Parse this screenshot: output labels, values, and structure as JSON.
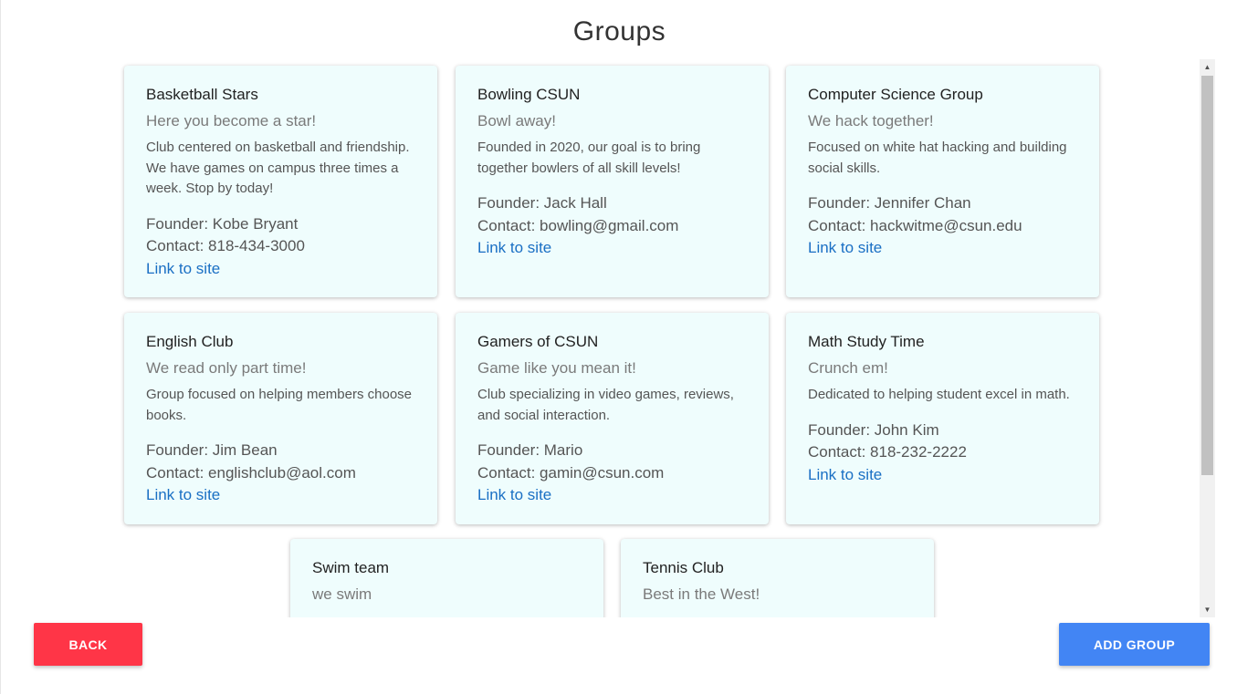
{
  "page": {
    "title": "Groups"
  },
  "groups": [
    {
      "name": "Basketball Stars",
      "tagline": "Here you become a star!",
      "description": "Club centered on basketball and friendship. We have games on campus three times a week. Stop by today!",
      "founder": "Founder: Kobe Bryant",
      "contact": "Contact: 818-434-3000",
      "link": "Link to site"
    },
    {
      "name": "Bowling CSUN",
      "tagline": "Bowl away!",
      "description": "Founded in 2020, our goal is to bring together bowlers of all skill levels!",
      "founder": "Founder: Jack Hall",
      "contact": "Contact: bowling@gmail.com",
      "link": "Link to site"
    },
    {
      "name": "Computer Science Group",
      "tagline": "We hack together!",
      "description": "Focused on white hat hacking and building social skills.",
      "founder": "Founder: Jennifer Chan",
      "contact": "Contact: hackwitme@csun.edu",
      "link": "Link to site"
    },
    {
      "name": "English Club",
      "tagline": "We read only part time!",
      "description": "Group focused on helping members choose books.",
      "founder": "Founder: Jim Bean",
      "contact": "Contact: englishclub@aol.com",
      "link": "Link to site"
    },
    {
      "name": "Gamers of CSUN",
      "tagline": "Game like you mean it!",
      "description": "Club specializing in video games, reviews, and social interaction.",
      "founder": "Founder: Mario",
      "contact": "Contact: gamin@csun.com",
      "link": "Link to site"
    },
    {
      "name": "Math Study Time",
      "tagline": "Crunch em!",
      "description": "Dedicated to helping student excel in math.",
      "founder": "Founder: John Kim",
      "contact": "Contact: 818-232-2222",
      "link": "Link to site"
    },
    {
      "name": "Swim team",
      "tagline": "we swim"
    },
    {
      "name": "Tennis Club",
      "tagline": "Best in the West!"
    }
  ],
  "buttons": {
    "back_label": "BACK",
    "add_group_label": "ADD GROUP"
  },
  "icons": {
    "scroll_up": "scroll-up-arrow-icon",
    "scroll_down": "scroll-down-arrow-icon"
  },
  "colors": {
    "card_background": "#effdfd",
    "link": "#1a6fc4",
    "back_button": "#ff3547",
    "add_group_button": "#4285f4"
  }
}
